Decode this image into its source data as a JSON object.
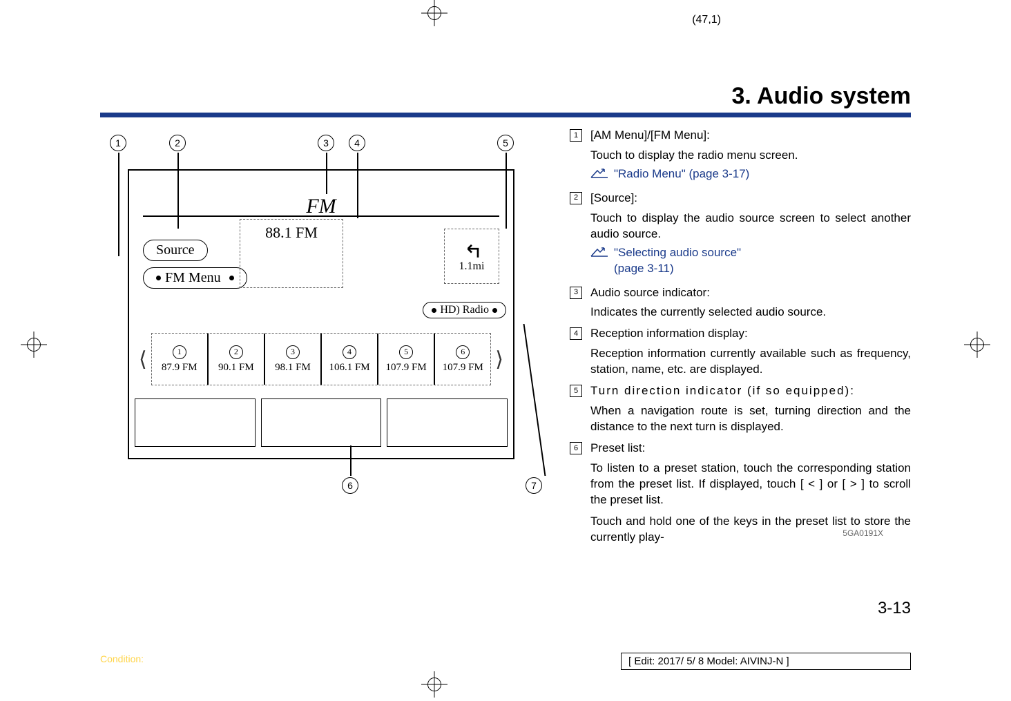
{
  "page_info_top": "(47,1)",
  "header_title": "3. Audio system",
  "figure": {
    "band_label": "FM",
    "source_btn": "Source",
    "menu_btn": "FM Menu",
    "frequency": "88.1 FM",
    "turn_distance": "1.1mi",
    "hd_badge": "HD) Radio",
    "presets": [
      {
        "n": "1",
        "freq": "87.9 FM"
      },
      {
        "n": "2",
        "freq": "90.1 FM"
      },
      {
        "n": "3",
        "freq": "98.1 FM"
      },
      {
        "n": "4",
        "freq": "106.1 FM"
      },
      {
        "n": "5",
        "freq": "107.9 FM"
      },
      {
        "n": "6",
        "freq": "107.9 FM"
      }
    ],
    "id": "5GA0191X",
    "callouts_top": [
      "1",
      "2",
      "3",
      "4",
      "5"
    ],
    "callouts_bottom": [
      "6",
      "7"
    ]
  },
  "items": {
    "i1": {
      "title": "[AM Menu]/[FM Menu]:",
      "body": "Touch to display the radio menu screen.",
      "ref": "\"Radio Menu\" (page 3-17)"
    },
    "i2": {
      "title": "[Source]:",
      "body": "Touch to display the audio source screen to select another audio source.",
      "ref_a": "\"Selecting audio source\"",
      "ref_b": "(page 3-11)"
    },
    "i3": {
      "title": "Audio source indicator:",
      "body": "Indicates the currently selected audio source."
    },
    "i4": {
      "title": "Reception information display:",
      "body": "Reception information currently available such as frequency, station, name, etc. are displayed."
    },
    "i5": {
      "title": "Turn direction indicator (if so equipped):",
      "body": "When a navigation route is set, turning direction and the distance to the next turn is displayed."
    },
    "i6": {
      "title": "Preset list:",
      "body_a": "To listen to a preset station, touch the corresponding station from the preset list. If displayed, touch [ < ] or [ > ] to scroll the preset list.",
      "body_b": "Touch and hold one of the keys in the preset list to store the currently play-"
    }
  },
  "page_number": "3-13",
  "condition_label": "Condition:",
  "edit_info": "[ Edit: 2017/ 5/ 8    Model:  AIVINJ-N ]"
}
